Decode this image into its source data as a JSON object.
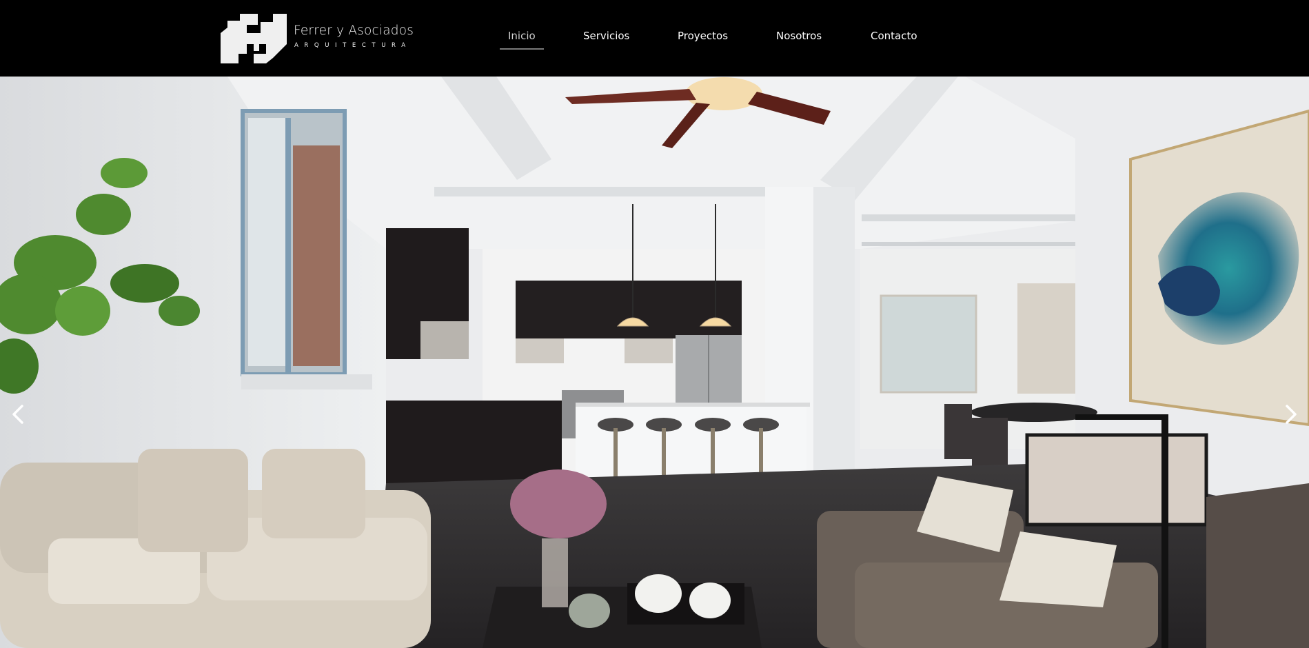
{
  "brand": {
    "name": "Ferrer y Asociados",
    "subtitle": "ARQUITECTURA"
  },
  "nav": {
    "items": [
      {
        "label": "Inicio",
        "active": true
      },
      {
        "label": "Servicios",
        "active": false
      },
      {
        "label": "Proyectos",
        "active": false
      },
      {
        "label": "Nosotros",
        "active": false
      },
      {
        "label": "Contacto",
        "active": false
      }
    ]
  },
  "hero": {
    "description_icon_prev": "chevron-left-icon",
    "description_icon_next": "chevron-right-icon"
  },
  "colors": {
    "header_bg": "#000000",
    "nav_text": "#ffffff",
    "nav_active": "#cfcfcf",
    "underline": "#7a7a7a"
  }
}
